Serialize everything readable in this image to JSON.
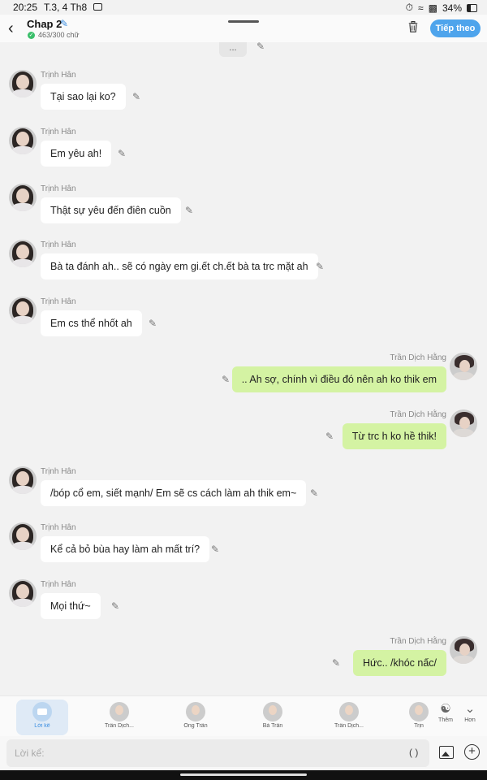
{
  "status_bar": {
    "time": "20:25",
    "date": "T.3, 4 Th8",
    "battery": "34%"
  },
  "header": {
    "title": "Chap 2",
    "word_count": "463/300 chữ",
    "next_button": "Tiếp theo",
    "accent_color": "#4ea4ec"
  },
  "chat": {
    "stub_text": "...",
    "messages": [
      {
        "side": "left",
        "name": "Trịnh Hân",
        "text": "Tại sao lại ko?"
      },
      {
        "side": "left",
        "name": "Trịnh Hân",
        "text": "Em yêu ah!"
      },
      {
        "side": "left",
        "name": "Trịnh Hân",
        "text": "Thật sự yêu đến điên cuồn"
      },
      {
        "side": "left",
        "name": "Trịnh Hân",
        "text": "Bà ta đánh ah.. sẽ có ngày em gi.ết ch.ết bà ta trc mặt ah"
      },
      {
        "side": "left",
        "name": "Trịnh Hân",
        "text": "Em cs thể nhốt ah"
      },
      {
        "side": "right",
        "name": "Trần Dịch Hằng",
        "text": ".. Ah sợ, chính vì điều đó nên ah ko thik em"
      },
      {
        "side": "right",
        "name": "Trần Dịch Hằng",
        "text": "Từ trc h ko hề thik!"
      },
      {
        "side": "left",
        "name": "Trịnh Hân",
        "text": "/bóp cổ em, siết mạnh/ Em sẽ cs cách làm ah thik em~"
      },
      {
        "side": "left",
        "name": "Trịnh Hân",
        "text": "Kể cả bỏ bùa hay làm ah mất trí?"
      },
      {
        "side": "left",
        "name": "Trịnh Hân",
        "text": "Mọi thứ~"
      },
      {
        "side": "right",
        "name": "Trần Dịch Hằng",
        "text": "Hức.. /khóc nấc/"
      }
    ]
  },
  "bottom_bar": {
    "characters": [
      {
        "label": "Lời kể"
      },
      {
        "label": "Trần Dịch..."
      },
      {
        "label": "Ông Trần"
      },
      {
        "label": "Bà Trần"
      },
      {
        "label": "Trần Dịch..."
      },
      {
        "label": "Trịn"
      }
    ],
    "add_label": "Thêm",
    "more_label": "Hơn"
  },
  "input": {
    "placeholder": "Lời kể:",
    "paren": "( )"
  }
}
